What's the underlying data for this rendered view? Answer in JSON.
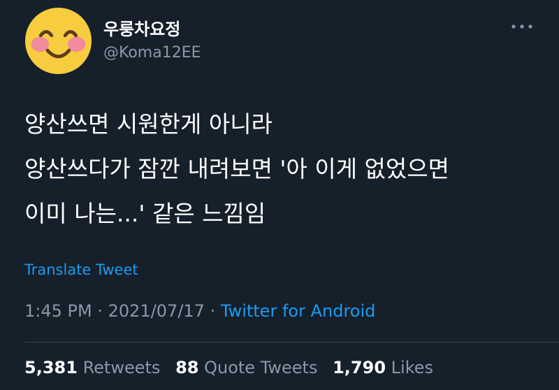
{
  "colors": {
    "background": "#15202b",
    "text_primary": "#ffffff",
    "text_secondary": "#8b98a5",
    "accent": "#1d9bf0",
    "divider": "#38444d"
  },
  "author": {
    "avatar_icon": "smiling-face-emoji-icon",
    "display_name": "우룽차요정",
    "handle": "@Koma12EE"
  },
  "more_icon": "more-options-icon",
  "tweet": {
    "lines": [
      "양산쓰면 시원한게 아니라",
      "양산쓰다가 잠깐 내려보면 '아 이게 없었으면",
      "이미 나는...' 같은 느낌임"
    ],
    "translate_label": "Translate Tweet",
    "time": "1:45 PM",
    "date": "2021/07/17",
    "separator": "·",
    "source": "Twitter for Android"
  },
  "stats": {
    "retweets_count": "5,381",
    "retweets_label": "Retweets",
    "quotes_count": "88",
    "quotes_label": "Quote Tweets",
    "likes_count": "1,790",
    "likes_label": "Likes"
  }
}
